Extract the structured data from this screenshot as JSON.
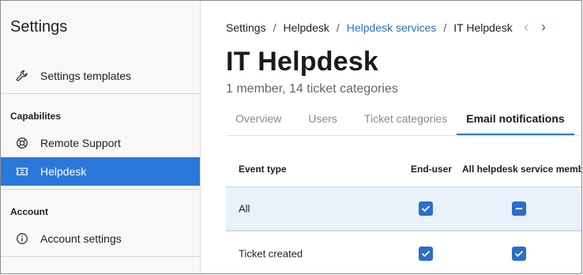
{
  "sidebar": {
    "title": "Settings",
    "items": [
      {
        "label": "Settings templates",
        "icon": "wrench-icon"
      },
      {
        "label": "Remote Support",
        "icon": "lifebuoy-icon"
      },
      {
        "label": "Helpdesk",
        "icon": "ticket-icon",
        "active": true
      },
      {
        "label": "Account settings",
        "icon": "info-icon"
      }
    ],
    "sections": [
      "Capabilites",
      "Account"
    ]
  },
  "breadcrumb": [
    "Settings",
    "Helpdesk",
    "Helpdesk services",
    "IT Helpdesk"
  ],
  "header": {
    "title": "IT Helpdesk",
    "subtitle": "1 member, 14 ticket categories"
  },
  "tabs": [
    "Overview",
    "Users",
    "Ticket categories",
    "Email notifications"
  ],
  "active_tab": "Email notifications",
  "table": {
    "headers": [
      "Event type",
      "End-user",
      "All helpdesk service members"
    ],
    "rows": [
      {
        "event": "All",
        "end_user": "checked",
        "all_members": "indeterminate"
      },
      {
        "event": "Ticket created",
        "end_user": "checked",
        "all_members": "checked"
      }
    ]
  },
  "colors": {
    "accent": "#2b78db",
    "link": "#2b6fc8",
    "row_highlight": "#e9f1fa"
  }
}
